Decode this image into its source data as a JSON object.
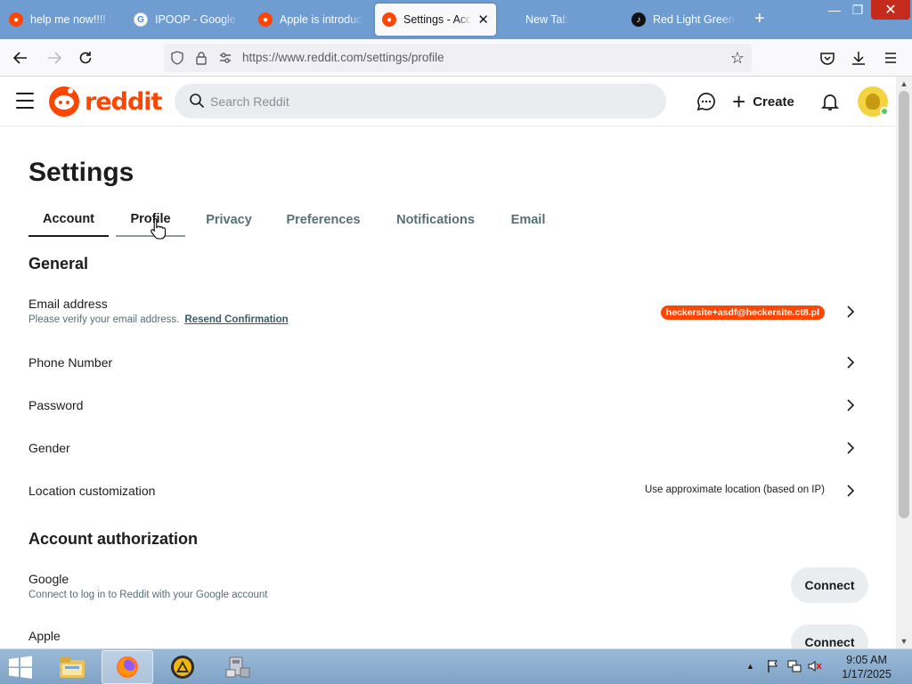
{
  "browser": {
    "tabs": [
      {
        "label": "help me now!!!! :(",
        "favicon": "reddit-icon",
        "active": false
      },
      {
        "label": "IPOOP - Google Search",
        "favicon": "google-icon",
        "active": false
      },
      {
        "label": "Apple is introducing",
        "favicon": "reddit-icon",
        "active": false
      },
      {
        "label": "Settings - Account",
        "favicon": "reddit-icon",
        "active": true
      },
      {
        "label": "New Tab",
        "favicon": "",
        "active": false
      },
      {
        "label": "Red Light Green Light",
        "favicon": "tiktok-icon",
        "active": false
      }
    ],
    "url": "https://www.reddit.com/settings/profile"
  },
  "header": {
    "logo_text": "reddit",
    "search_placeholder": "Search Reddit",
    "create_label": "Create"
  },
  "settings": {
    "title": "Settings",
    "tabs": [
      "Account",
      "Profile",
      "Privacy",
      "Preferences",
      "Notifications",
      "Email"
    ],
    "active_tab": "Account",
    "general": {
      "title": "General",
      "email_label": "Email address",
      "email_sub": "Please verify your email address.",
      "resend_label": "Resend Confirmation",
      "email_value": "heckersite+asdf@heckersite.ct8.pl",
      "phone_label": "Phone Number",
      "password_label": "Password",
      "gender_label": "Gender",
      "location_label": "Location customization",
      "location_value": "Use approximate location (based on IP)"
    },
    "auth": {
      "title": "Account authorization",
      "google_label": "Google",
      "google_sub": "Connect to log in to Reddit with your Google account",
      "apple_label": "Apple",
      "connect_label": "Connect"
    }
  },
  "taskbar": {
    "time": "9:05 AM",
    "date": "1/17/2025"
  },
  "colors": {
    "brand": "#ff4500",
    "tabstrip": "#6f9dd1",
    "muted_text": "#576f76"
  }
}
